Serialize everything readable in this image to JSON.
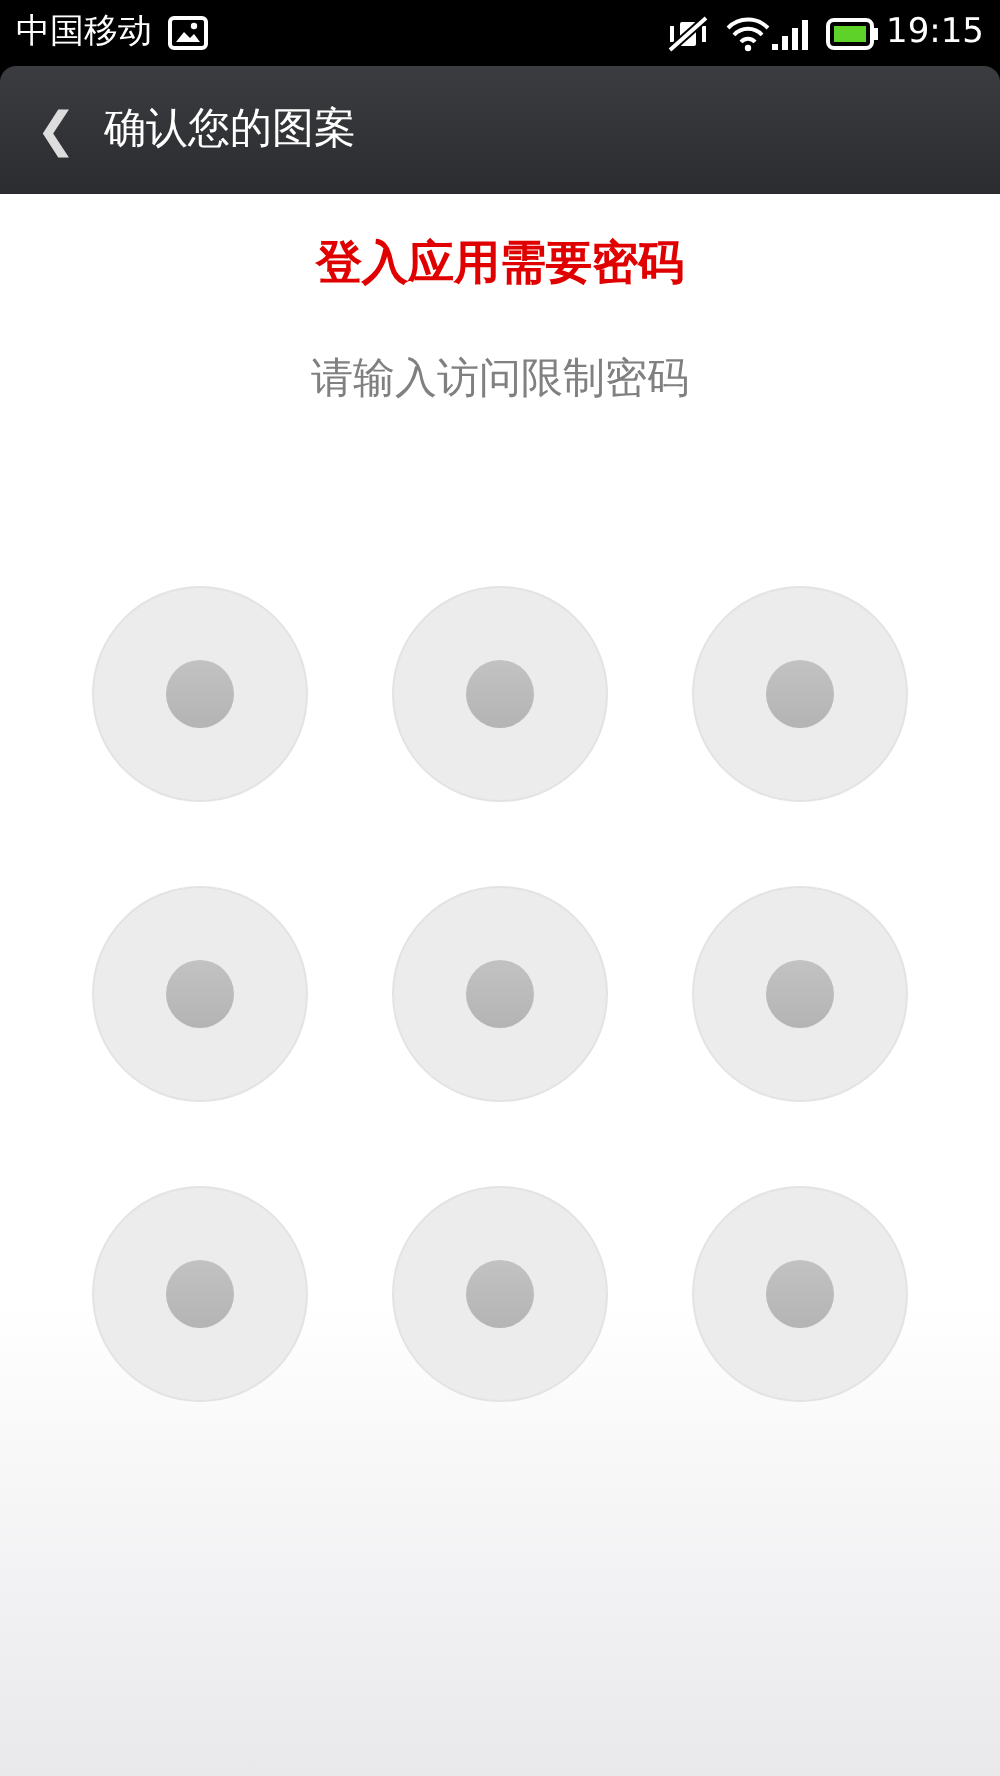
{
  "status_bar": {
    "carrier": "中国移动",
    "time": "19:15"
  },
  "header": {
    "back": "❮",
    "title": "确认您的图案"
  },
  "prompt": {
    "title": "登入应用需要密码",
    "subtitle": "请输入访问限制密码"
  },
  "pattern": {
    "dots": [
      {
        "selected": false
      },
      {
        "selected": false
      },
      {
        "selected": false
      },
      {
        "selected": false
      },
      {
        "selected": false
      },
      {
        "selected": false
      },
      {
        "selected": false
      },
      {
        "selected": false
      },
      {
        "selected": false
      }
    ]
  }
}
